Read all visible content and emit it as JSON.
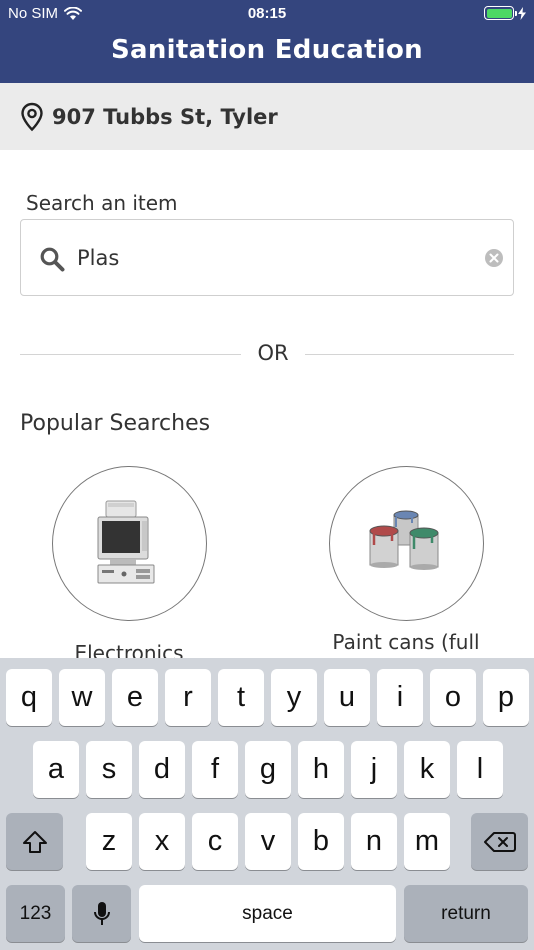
{
  "status_bar": {
    "carrier": "No SIM",
    "time": "08:15"
  },
  "header": {
    "title": "Sanitation Education"
  },
  "location": {
    "address": "907 Tubbs St, Tyler"
  },
  "search": {
    "label": "Search an item",
    "value": "Plas"
  },
  "divider": {
    "text": "OR"
  },
  "popular": {
    "title": "Popular Searches",
    "items": [
      {
        "label": "Electronics",
        "icon": "computer-icon"
      },
      {
        "label": "Paint cans (full",
        "icon": "paint-cans-icon"
      }
    ]
  },
  "keyboard": {
    "row1": [
      "q",
      "w",
      "e",
      "r",
      "t",
      "y",
      "u",
      "i",
      "o",
      "p"
    ],
    "row2": [
      "a",
      "s",
      "d",
      "f",
      "g",
      "h",
      "j",
      "k",
      "l"
    ],
    "row3": [
      "z",
      "x",
      "c",
      "v",
      "b",
      "n",
      "m"
    ],
    "numbers_key": "123",
    "space_key": "space",
    "return_key": "return"
  },
  "colors": {
    "header": "#34457e",
    "location_bar": "#ebebeb",
    "keyboard": "#d1d5db",
    "battery": "#4cd964"
  }
}
